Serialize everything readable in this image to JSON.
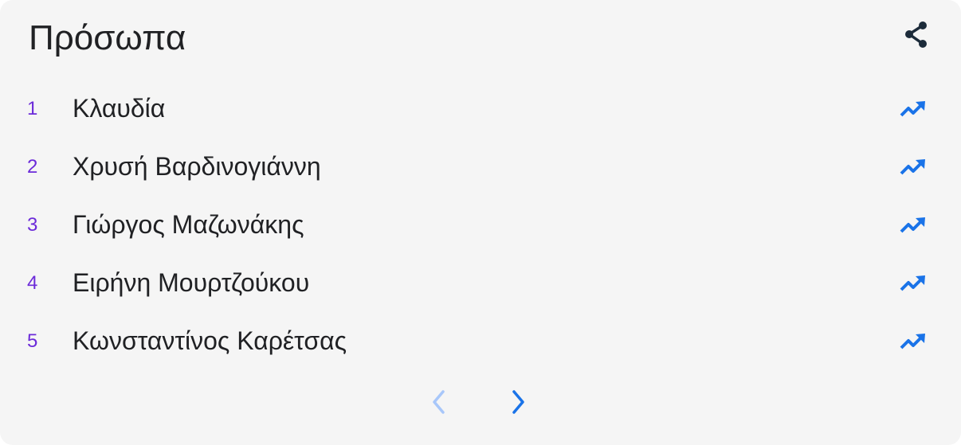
{
  "header": {
    "title": "Πρόσωπα"
  },
  "icons": {
    "share": "share-icon",
    "trend": "trending-up-icon",
    "prev": "chevron-left-icon",
    "next": "chevron-right-icon"
  },
  "colors": {
    "card_background": "#f5f5f5",
    "rank": "#6c2bd9",
    "trend": "#1a73e8",
    "pager_active": "#1a73e8",
    "pager_disabled": "#a8c7fa",
    "share": "#1c2b3a"
  },
  "list": {
    "items": [
      {
        "rank": "1",
        "name": "Κλαυδία"
      },
      {
        "rank": "2",
        "name": "Χρυσή Βαρδινογιάννη"
      },
      {
        "rank": "3",
        "name": "Γιώργος Μαζωνάκης"
      },
      {
        "rank": "4",
        "name": "Ειρήνη Μουρτζούκου"
      },
      {
        "rank": "5",
        "name": "Κωνσταντίνος Καρέτσας"
      }
    ]
  },
  "pager": {
    "prev_enabled": false,
    "next_enabled": true
  }
}
